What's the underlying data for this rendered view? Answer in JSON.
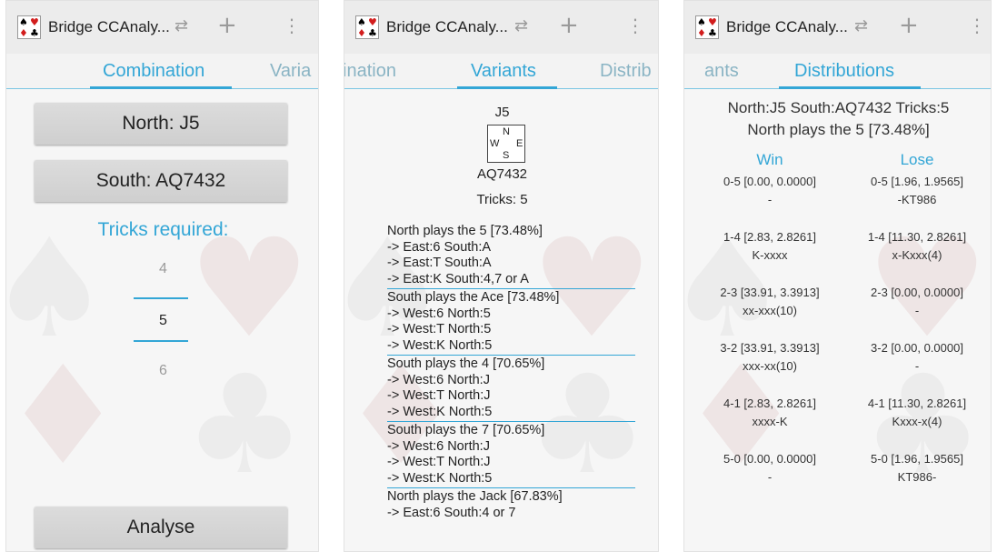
{
  "app_title": "Bridge CCAnaly...",
  "icons": {
    "app": "bridge-suits-app-icon",
    "swap": "swap-arrows-icon",
    "add": "plus-icon",
    "menu": "overflow-menu-icon"
  },
  "colors": {
    "accent": "#33a6d6",
    "background": "#f6f6f6",
    "actionbar": "#ececec"
  },
  "screen1": {
    "tabs": [
      "Combination",
      "Varia"
    ],
    "north_button": "North: J5",
    "south_button": "South: AQ7432",
    "tricks_label": "Tricks required:",
    "picker": {
      "above": "4",
      "selected": "5",
      "below": "6"
    },
    "analyse_button": "Analyse"
  },
  "screen2": {
    "tabs": [
      "ination",
      "Variants",
      "Distrib"
    ],
    "north_cards": "J5",
    "compass": {
      "n": "N",
      "w": "W",
      "e": "E",
      "s": "S"
    },
    "south_cards": "AQ7432",
    "tricks": "Tricks: 5",
    "variants": [
      {
        "title": "North plays the 5 [73.48%]",
        "lines": [
          "-> East:6  South:A",
          "-> East:T  South:A",
          "-> East:K  South:4,7 or A"
        ]
      },
      {
        "title": "South plays the Ace [73.48%]",
        "lines": [
          "-> West:6  North:5",
          "-> West:T  North:5",
          "-> West:K  North:5"
        ]
      },
      {
        "title": "South plays the 4 [70.65%]",
        "lines": [
          "-> West:6  North:J",
          "-> West:T  North:J",
          "-> West:K  North:5"
        ]
      },
      {
        "title": "South plays the 7 [70.65%]",
        "lines": [
          "-> West:6  North:J",
          "-> West:T  North:J",
          "-> West:K  North:5"
        ]
      },
      {
        "title": "North plays the Jack [67.83%]",
        "lines": [
          "-> East:6  South:4 or 7"
        ]
      }
    ]
  },
  "screen3": {
    "tabs": [
      "ants",
      "Distributions"
    ],
    "header_line1": "North:J5 South:AQ7432 Tricks:5",
    "header_line2": "North plays the 5 [73.48%]",
    "win_header": "Win",
    "lose_header": "Lose",
    "rows": [
      {
        "win_split": "0-5 [0.00, 0.0000]",
        "win_cards": "-",
        "lose_split": "0-5 [1.96, 1.9565]",
        "lose_cards": "-KT986"
      },
      {
        "win_split": "1-4 [2.83, 2.8261]",
        "win_cards": "K-xxxx",
        "lose_split": "1-4 [11.30, 2.8261]",
        "lose_cards": "x-Kxxx(4)"
      },
      {
        "win_split": "2-3 [33.91, 3.3913]",
        "win_cards": "xx-xxx(10)",
        "lose_split": "2-3 [0.00, 0.0000]",
        "lose_cards": "-"
      },
      {
        "win_split": "3-2 [33.91, 3.3913]",
        "win_cards": "xxx-xx(10)",
        "lose_split": "3-2 [0.00, 0.0000]",
        "lose_cards": "-"
      },
      {
        "win_split": "4-1 [2.83, 2.8261]",
        "win_cards": "xxxx-K",
        "lose_split": "4-1 [11.30, 2.8261]",
        "lose_cards": "Kxxx-x(4)"
      },
      {
        "win_split": "5-0 [0.00, 0.0000]",
        "win_cards": "-",
        "lose_split": "5-0 [1.96, 1.9565]",
        "lose_cards": "KT986-"
      }
    ]
  }
}
